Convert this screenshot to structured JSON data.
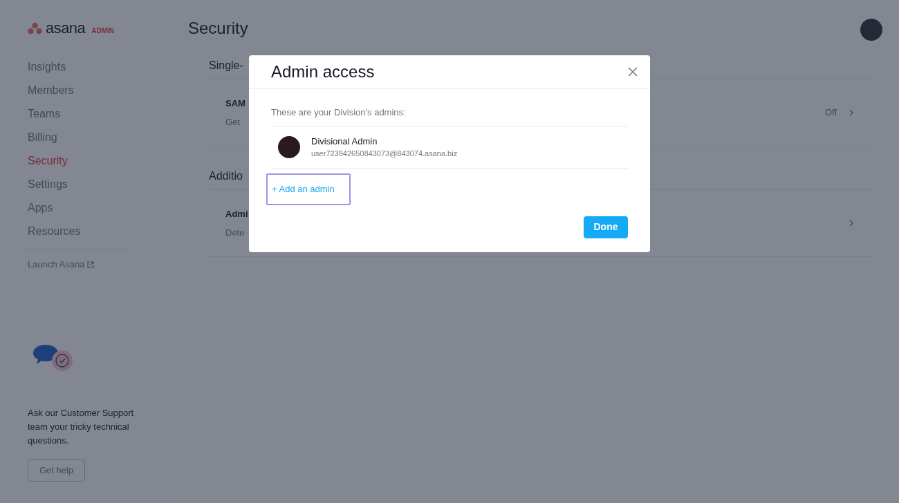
{
  "sidebar": {
    "logo": {
      "wordmark": "asana",
      "badge": "ADMIN"
    },
    "items": [
      {
        "label": "Insights",
        "selected": false
      },
      {
        "label": "Members",
        "selected": false
      },
      {
        "label": "Teams",
        "selected": false
      },
      {
        "label": "Billing",
        "selected": false
      },
      {
        "label": "Security",
        "selected": true
      },
      {
        "label": "Settings",
        "selected": false
      },
      {
        "label": "Apps",
        "selected": false
      },
      {
        "label": "Resources",
        "selected": false
      }
    ],
    "launch_link": "Launch Asana",
    "support": {
      "text": "Ask our Customer Support team your tricky technical questions.",
      "button": "Get help"
    }
  },
  "page": {
    "title": "Security",
    "sections": [
      {
        "title": "Single-",
        "rows": [
          {
            "title": "SAM",
            "description": "Get",
            "value": "Off"
          }
        ]
      },
      {
        "title": "Additio",
        "rows": [
          {
            "title": "Admi",
            "description": "Dete"
          }
        ]
      }
    ]
  },
  "dialog": {
    "title": "Admin access",
    "intro": "These are your Division's admins:",
    "admins": [
      {
        "name": "Divisional Admin",
        "email": "user723942650843073@843074.asana.biz"
      }
    ],
    "add_link": {
      "label": "+ Add an admin",
      "focused": true
    },
    "primary_button": "Done"
  }
}
